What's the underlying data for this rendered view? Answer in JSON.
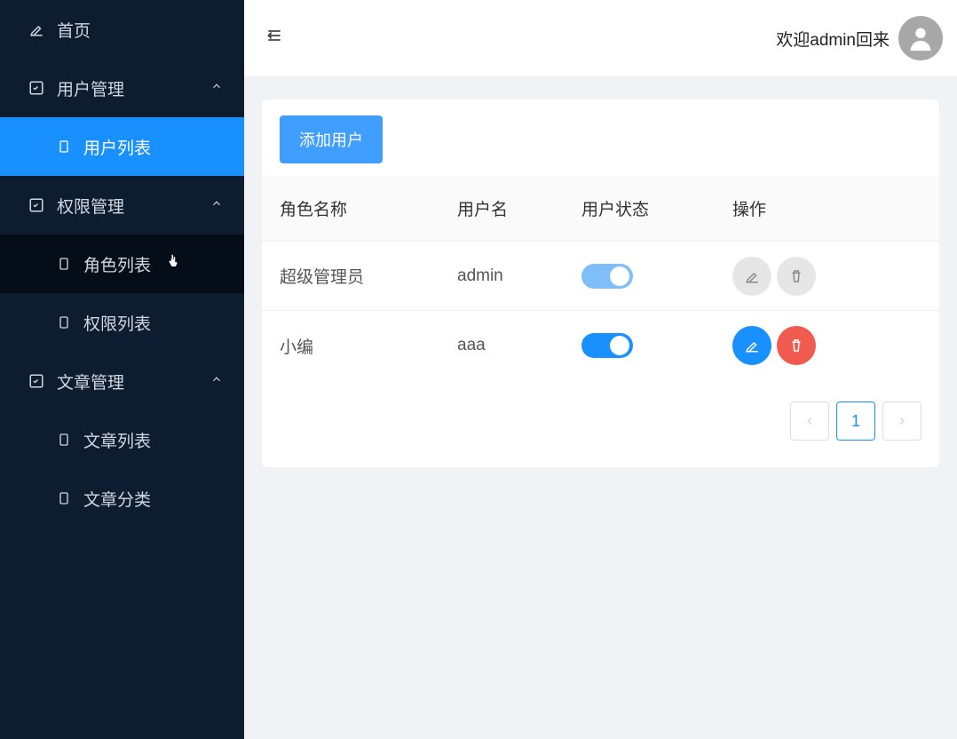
{
  "sidebar": {
    "home": "首页",
    "user_mgmt": "用户管理",
    "user_list": "用户列表",
    "perm_mgmt": "权限管理",
    "role_list": "角色列表",
    "perm_list": "权限列表",
    "article_mgmt": "文章管理",
    "article_list": "文章列表",
    "article_cat": "文章分类"
  },
  "header": {
    "welcome": "欢迎admin回来"
  },
  "table": {
    "add_button": "添加用户",
    "headers": {
      "role": "角色名称",
      "user": "用户名",
      "status": "用户状态",
      "action": "操作"
    },
    "rows": [
      {
        "role": "超级管理员",
        "user": "admin",
        "status_on": true,
        "disabled": true
      },
      {
        "role": "小编",
        "user": "aaa",
        "status_on": true,
        "disabled": false
      }
    ]
  },
  "pagination": {
    "current": "1"
  }
}
